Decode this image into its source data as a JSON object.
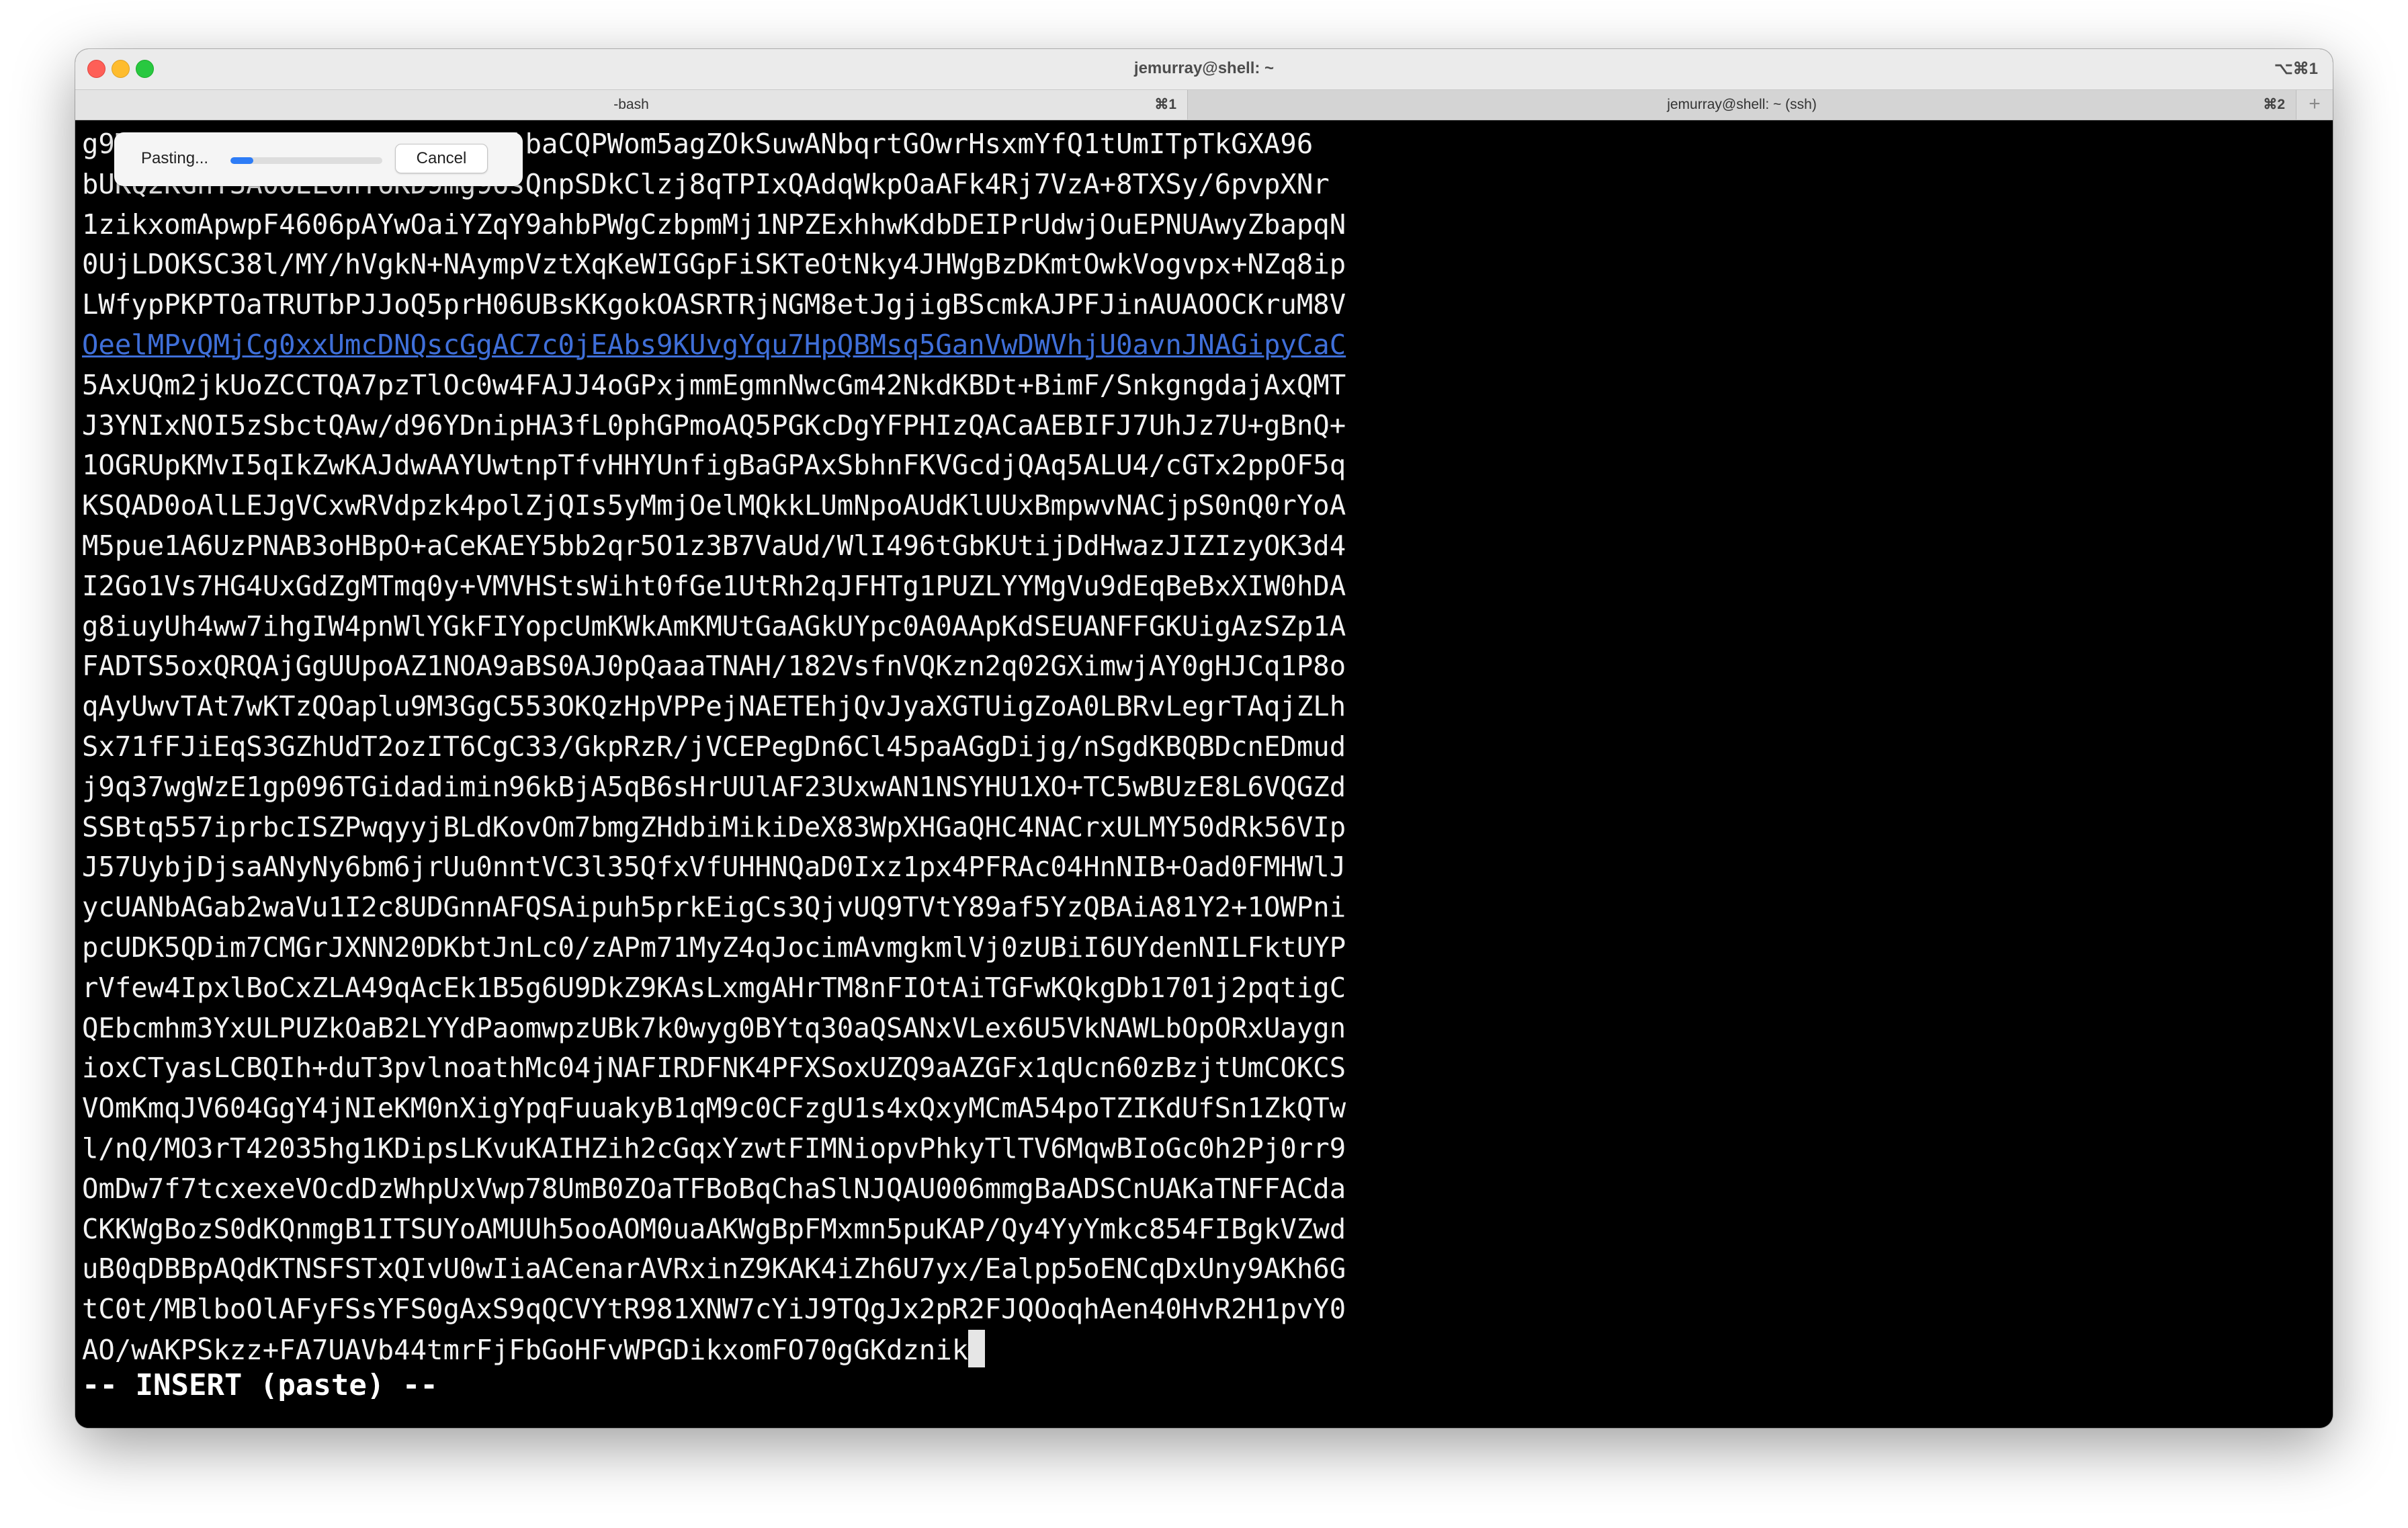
{
  "window": {
    "title": "jemurray@shell: ~",
    "shortcut": "⌥⌘1"
  },
  "tabs": [
    {
      "label": "-bash",
      "shortcut": "⌘1"
    },
    {
      "label": "jemurray@shell: ~ (ssh)",
      "shortcut": "⌘2"
    }
  ],
  "new_tab_icon": "+",
  "colors": {
    "link": "#3f6fd9",
    "progress": "#2d7cf6",
    "close": "#fe5f57",
    "minimize": "#febc2e",
    "maximize": "#28c840"
  },
  "paste_dialog": {
    "label": "Pasting...",
    "progress_fraction": 0.15,
    "cancel_label": "Cancel"
  },
  "terminal": {
    "lines": [
      {
        "text": "g9MkLeHZDOBuOGRsJ2u3cHGc9KlbaCQPWom5agZOkSuwANbqrtGOwrHsxmYfQ1tUmITpTkGXA96"
      },
      {
        "text": "bUKQ2KGhT3A0OEL0nT6KD9mg96sQnpSDkClzj8qTPIxQAdqWkpOaAFk4Rj7VzA+8TXSy/6pvpXNr"
      },
      {
        "text": "1zikxomApwpF4606pAYwOaiYZqY9ahbPWgCzbpmMj1NPZExhhwKdbDEIPrUdwjOuEPNUAwyZbapqN"
      },
      {
        "text": "0UjLDOKSC38l/MY/hVgkN+NAympVztXqKeWIGGpFiSKTeOtNky4JHWgBzDKmtOwkVogvpx+NZq8ip"
      },
      {
        "text": "LWfypPKPTOaTRUTbPJJoQ5prH06UBsKKgokOASRTRjNGM8etJgjigBScmkAJPFJinAUAOOCKruM8V"
      },
      {
        "text": "OeelMPvQMjCg0xxUmcDNQscGgAC7c0jEAbs9KUvgYqu7HpQBMsq5GanVwDWVhjU0avnJNAGipyCaC",
        "link": true
      },
      {
        "text": "5AxUQm2jkUoZCCTQA7pzTlOc0w4FAJJ4oGPxjmmEgmnNwcGm42NkdKBDt+BimF/SnkgngdajAxQMT"
      },
      {
        "text": "J3YNIxNOI5zSbctQAw/d96YDnipHA3fL0phGPmoAQ5PGKcDgYFPHIzQACaAEBIFJ7UhJz7U+gBnQ+"
      },
      {
        "text": "1OGRUpKMvI5qIkZwKAJdwAAYUwtnpTfvHHYUnfigBaGPAxSbhnFKVGcdjQAq5ALU4/cGTx2ppOF5q"
      },
      {
        "text": "KSQAD0oAlLEJgVCxwRVdpzk4polZjQIs5yMmjOelMQkkLUmNpoAUdKlUUxBmpwvNACjpS0nQ0rYoA"
      },
      {
        "text": "M5pue1A6UzPNAB3oHBpO+aCeKAEY5bb2qr5O1z3B7VaUd/WlI496tGbKUtijDdHwazJIZIzyOK3d4"
      },
      {
        "text": "I2Go1Vs7HG4UxGdZgMTmq0y+VMVHStsWiht0fGe1UtRh2qJFHTg1PUZLYYMgVu9dEqBeBxXIW0hDA"
      },
      {
        "text": "g8iuyUh4ww7ihgIW4pnWlYGkFIYopcUmKWkAmKMUtGaAGkUYpc0A0AApKdSEUANFFGKUigAzSZp1A"
      },
      {
        "text": "FADTS5oxQRQAjGgUUpoAZ1NOA9aBS0AJ0pQaaaTNAH/182VsfnVQKzn2q02GXimwjAY0gHJCq1P8o"
      },
      {
        "text": "qAyUwvTAt7wKTzQOaplu9M3GgC553OKQzHpVPPejNAETEhjQvJyaXGTUigZoA0LBRvLegrTAqjZLh"
      },
      {
        "text": "Sx71fFJiEqS3GZhUdT2ozIT6CgC33/GkpRzR/jVCEPegDn6Cl45paAGgDijg/nSgdKBQBDcnEDmud"
      },
      {
        "text": "j9q37wgWzE1gp096TGidadimin96kBjA5qB6sHrUUlAF23UxwAN1NSYHU1XO+TC5wBUzE8L6VQGZd"
      },
      {
        "text": "SSBtq557iprbcISZPwqyyjBLdKovOm7bmgZHdbiMikiDeX83WpXHGaQHC4NACrxULMY50dRk56VIp"
      },
      {
        "text": "J57UybjDjsaANyNy6bm6jrUu0nntVC3l35QfxVfUHHNQaD0Ixz1px4PFRAc04HnNIB+Oad0FMHWlJ"
      },
      {
        "text": "ycUANbAGab2waVu1I2c8UDGnnAFQSAipuh5prkEigCs3QjvUQ9TVtY89af5YzQBAiA81Y2+1OWPni"
      },
      {
        "text": "pcUDK5QDim7CMGrJXNN20DKbtJnLc0/zAPm71MyZ4qJocimAvmgkmlVj0zUBiI6UYdenNILFktUYP"
      },
      {
        "text": "rVfew4IpxlBoCxZLA49qAcEk1B5g6U9DkZ9KAsLxmgAHrTM8nFIOtAiTGFwKQkgDb1701j2pqtigC"
      },
      {
        "text": "QEbcmhm3YxULPUZkOaB2LYYdPaomwpzUBk7k0wyg0BYtq30aQSANxVLex6U5VkNAWLbOpORxUaygn"
      },
      {
        "text": "ioxCTyasLCBQIh+duT3pvlnoathMc04jNAFIRDFNK4PFXSoxUZQ9aAZGFx1qUcn60zBzjtUmCOKCS"
      },
      {
        "text": "VOmKmqJV604GgY4jNIeKM0nXigYpqFuuakyB1qM9c0CFzgU1s4xQxyMCmA54poTZIKdUfSn1ZkQTw"
      },
      {
        "text": "l/nQ/MO3rT42035hg1KDipsLKvuKAIHZih2cGqxYzwtFIMNiopvPhkyTlTV6MqwBIoGc0h2Pj0rr9"
      },
      {
        "text": "OmDw7f7tcxexeVOcdDzWhpUxVwp78UmB0ZOaTFBoBqChaSlNJQAU006mmgBaADSCnUAKaTNFFACda"
      },
      {
        "text": "CKKWgBozS0dKQnmgB1ITSUYoAMUUh5ooAOM0uaAKWgBpFMxmn5puKAP/Qy4YyYmkc854FIBgkVZwd"
      },
      {
        "text": "uB0qDBBpAQdKTNSFSTxQIvU0wIiaACenarAVRxinZ9KAK4iZh6U7yx/Ealpp5oENCqDxUny9AKh6G"
      },
      {
        "text": "tC0t/MBlboOlAFyFSsYFS0gAxS9qQCVYtR981XNW7cYiJ9TQgJx2pR2FJQOoqhAen40HvR2H1pvY0"
      },
      {
        "text": "AO/wAKPSkzz+FA7UAVb44tmrFjFbGoHFvWPGDikxomFO70gGKdznik"
      }
    ],
    "status_line": "-- INSERT (paste) --"
  }
}
